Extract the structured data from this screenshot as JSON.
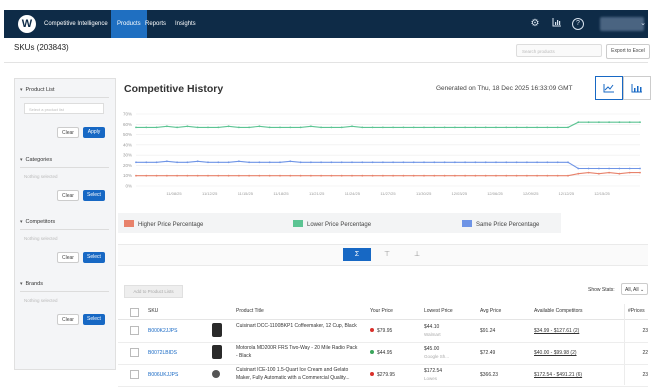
{
  "nav": {
    "logo_letter": "W",
    "items": [
      "Competitive Intelligence",
      "Products",
      "Reports",
      "Insights"
    ],
    "active": "Products"
  },
  "header": {
    "title": "SKUs (203843)",
    "search_placeholder": "Search products",
    "export_label": "Export to Excel"
  },
  "filters": [
    {
      "title": "Product List",
      "select_placeholder": "Select a product list",
      "clear": "Clear",
      "action": "Apply"
    },
    {
      "title": "Categories",
      "hint": "Nothing selected",
      "clear": "Clear",
      "action": "Select"
    },
    {
      "title": "Competitors",
      "hint": "Nothing selected",
      "clear": "Clear",
      "action": "Select"
    },
    {
      "title": "Brands",
      "hint": "Nothing selected",
      "clear": "Clear",
      "action": "Select"
    }
  ],
  "history": {
    "title": "Competitive History",
    "generated": "Generated on Thu, 18 Dec 2025 16:33:09 GMT"
  },
  "chart_data": {
    "type": "line",
    "ylim": [
      0,
      70
    ],
    "y_ticks": [
      "0%",
      "10%",
      "20%",
      "30%",
      "40%",
      "50%",
      "60%",
      "70%"
    ],
    "x_ticks": [
      "11/08/25",
      "11/12/25",
      "11/15/25",
      "11/18/25",
      "11/21/25",
      "11/24/25",
      "11/27/25",
      "11/30/25",
      "12/03/25",
      "12/06/25",
      "12/09/25",
      "12/12/25",
      "12/15/25"
    ],
    "series": [
      {
        "name": "Higher Price Percentage",
        "color": "#e8826b",
        "values": [
          10,
          10,
          10,
          10,
          10,
          10,
          10,
          10,
          10,
          10,
          10,
          10,
          10,
          10,
          10,
          10,
          10,
          10,
          10,
          10,
          10,
          10,
          10,
          10,
          10,
          10,
          10,
          10,
          10,
          10,
          10,
          10,
          10,
          10,
          10,
          10,
          10,
          10,
          10,
          10,
          10,
          10,
          10,
          12,
          13,
          12,
          13,
          12,
          13,
          13
        ]
      },
      {
        "name": "Lower Price Percentage",
        "color": "#5cc493",
        "values": [
          57,
          57,
          57,
          58,
          57,
          58,
          57,
          57,
          57,
          58,
          57,
          57,
          58,
          57,
          57,
          57,
          57,
          58,
          57,
          57,
          57,
          58,
          57,
          57,
          57,
          57,
          57,
          57,
          57,
          57,
          57,
          57,
          57,
          57,
          57,
          57,
          57,
          57,
          57,
          57,
          57,
          57,
          57,
          62,
          62,
          62,
          62,
          62,
          62,
          62
        ]
      },
      {
        "name": "Same Price Percentage",
        "color": "#6e94e6",
        "values": [
          23,
          23,
          23,
          24,
          23,
          23,
          24,
          23,
          23,
          23,
          24,
          23,
          23,
          23,
          23,
          24,
          23,
          23,
          23,
          23,
          23,
          23,
          23,
          23,
          23,
          23,
          23,
          23,
          23,
          23,
          23,
          23,
          23,
          23,
          23,
          23,
          23,
          23,
          23,
          23,
          23,
          23,
          23,
          17,
          17,
          17,
          17,
          17,
          17,
          17
        ]
      }
    ]
  },
  "segments": [
    "Σ",
    "⊤",
    "⊥"
  ],
  "table": {
    "add_label": "Add to Product Lists",
    "show_stats_label": "Show Stats:",
    "show_stats_value": "All, All",
    "columns": [
      "SKU",
      "Product Title",
      "Your Price",
      "Lowest Price",
      "Avg Price",
      "Available Competitors",
      "#Prices"
    ],
    "rows": [
      {
        "sku": "B000K2JJPS",
        "title": "Cuisinart DCC-1100BKP1 Coffeemaker, 12 Cup, Black",
        "your_price": "$79.95",
        "status_color": "#d9302b",
        "lowest": "$44.10",
        "lowest_source": "Walmart",
        "avg": "$91.24",
        "competitors": "$34.99 - $127.61 (2)",
        "prices": "23"
      },
      {
        "sku": "B0072LBIDS",
        "title": "Motorola MD200R FRS Two-Way - 20 Mile Radio Pack - Black",
        "your_price": "$44.95",
        "status_color": "#3aa55b",
        "lowest": "$45.00",
        "lowest_source": "Google Sh...",
        "avg": "$72.49",
        "competitors": "$40.00 - $99.98 (2)",
        "prices": "22"
      },
      {
        "sku": "B006UKJJPS",
        "title": "Cuisinart ICE-100 1.5-Quart Ice Cream and Gelato Maker, Fully Automatic with a Commercial Quality...",
        "your_price": "$279.95",
        "status_color": "#d9302b",
        "lowest": "$172.54",
        "lowest_source": "Lowes",
        "avg": "$366.23",
        "competitors": "$172.54 - $491.21 (6)",
        "prices": "23"
      }
    ]
  }
}
